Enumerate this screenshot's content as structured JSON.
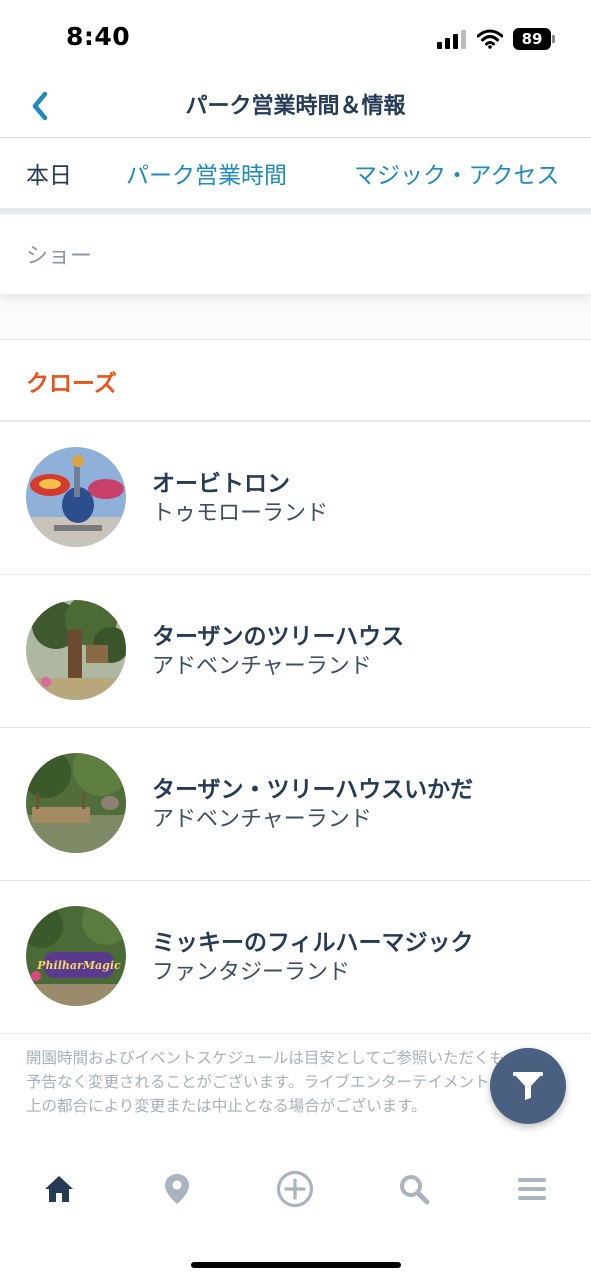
{
  "status_bar": {
    "time": "8:40",
    "battery": "89"
  },
  "header": {
    "title": "パーク営業時間＆情報",
    "back_icon": "chevron-left-icon"
  },
  "tabs": [
    {
      "label": "本日",
      "active": true
    },
    {
      "label": "パーク営業時間",
      "active": false
    },
    {
      "label": "マジック・アクセス",
      "active": false
    }
  ],
  "sub_filter": {
    "label": "ショー"
  },
  "section": {
    "label": "クローズ"
  },
  "attractions": [
    {
      "name": "オービトロン",
      "area": "トゥモローランド"
    },
    {
      "name": "ターザンのツリーハウス",
      "area": "アドベンチャーランド"
    },
    {
      "name": "ターザン・ツリーハウスいかだ",
      "area": "アドベンチャーランド"
    },
    {
      "name": "ミッキーのフィルハーマジック",
      "area": "ファンタジーランド"
    }
  ],
  "disclaimer": "開園時間およびイベントスケジュールは目安としてご参照いただくもので、予告なく変更されることがございます。ライブエンターテイメントは、運営上の都合により変更または中止となる場合がございます。",
  "thumbnail_signs": {
    "philharmagic": "PhilharMagic"
  },
  "bottom_nav": [
    {
      "icon": "home-icon",
      "active": true
    },
    {
      "icon": "map-pin-icon",
      "active": false
    },
    {
      "icon": "plus-circle-icon",
      "active": false
    },
    {
      "icon": "search-icon",
      "active": false
    },
    {
      "icon": "menu-icon",
      "active": false
    }
  ],
  "colors": {
    "accent": "#1f8ac0",
    "closed": "#e8541a",
    "text": "#253b56",
    "fab": "#4a6080"
  }
}
